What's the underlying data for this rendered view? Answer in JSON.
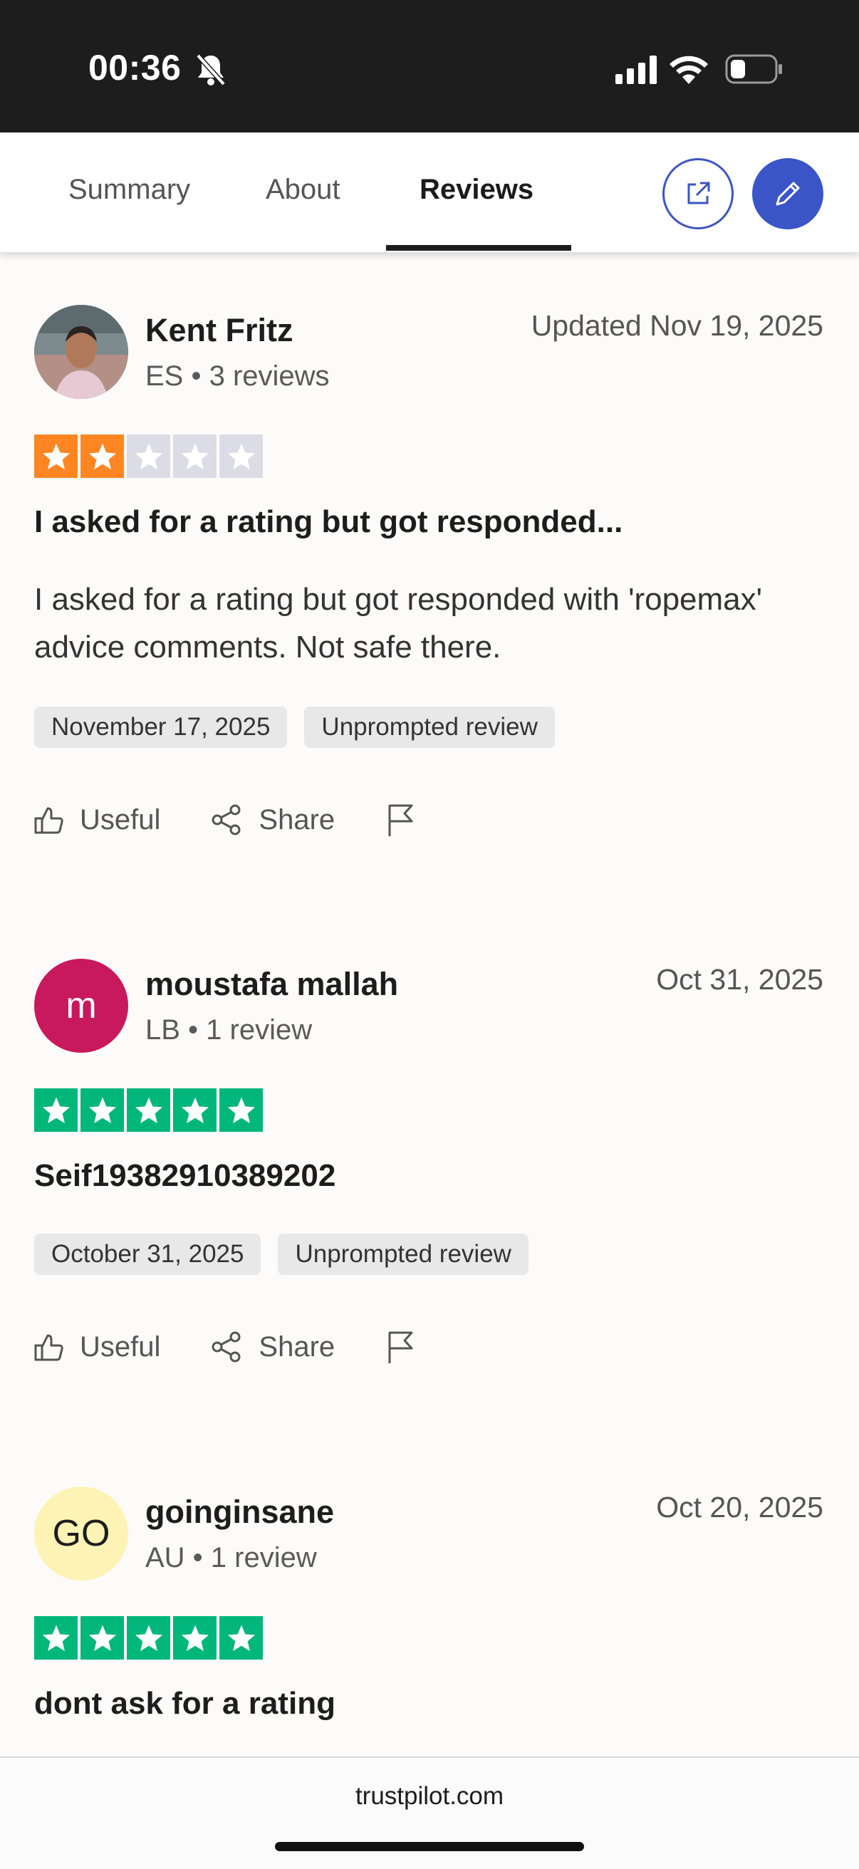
{
  "status_bar": {
    "time": "00:36"
  },
  "tabs": {
    "summary": "Summary",
    "about": "About",
    "reviews": "Reviews",
    "active": "Reviews"
  },
  "colors": {
    "accent": "#3b55c8",
    "star_orange": "#ff8622",
    "star_green": "#00b67a",
    "star_empty": "#dcdce6"
  },
  "reviews": [
    {
      "name": "Kent Fritz",
      "meta": "ES • 3 reviews",
      "date": "Updated Nov 19, 2025",
      "rating": 2,
      "title": "I asked for a rating but got responded...",
      "body": "I asked for a rating but got responded with 'ropemax' advice comments. Not safe there.",
      "chips": [
        "November 17, 2025",
        "Unprompted review"
      ],
      "useful": "Useful",
      "share": "Share"
    },
    {
      "name": "moustafa mallah",
      "initials": "m",
      "meta": "LB • 1 review",
      "date": "Oct 31, 2025",
      "rating": 5,
      "title": "Seif19382910389202",
      "chips": [
        "October 31, 2025",
        "Unprompted review"
      ],
      "useful": "Useful",
      "share": "Share"
    },
    {
      "name": "goinginsane",
      "initials": "GO",
      "meta": "AU • 1 review",
      "date": "Oct 20, 2025",
      "rating": 5,
      "title": "dont ask for a rating"
    }
  ],
  "footer": {
    "url": "trustpilot.com"
  }
}
